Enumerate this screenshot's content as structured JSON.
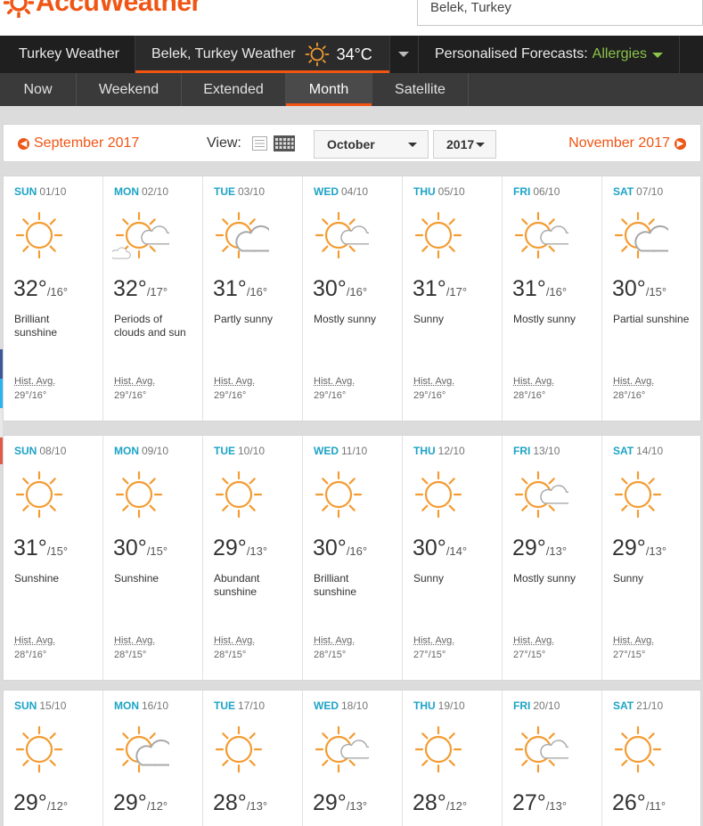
{
  "header": {
    "logo_text": "AccuWeather",
    "search_value": "Belek, Turkey"
  },
  "nav1": {
    "country": "Turkey Weather",
    "city": "Belek, Turkey Weather",
    "current_temp": "34°C",
    "personalised_label": "Personalised Forecasts:",
    "personalised_value": "Allergies"
  },
  "nav2": {
    "tabs": [
      "Now",
      "Weekend",
      "Extended",
      "Month",
      "Satellite"
    ],
    "active": "Month"
  },
  "controls": {
    "prev_month": "September 2017",
    "view_label": "View:",
    "month_select": "October",
    "year_select": "2017",
    "next_month": "November 2017"
  },
  "hist_label": "Hist. Avg.",
  "weeks": [
    [
      {
        "dow": "SUN",
        "date": "01/10",
        "icon": "sun-icon",
        "hi": "32°",
        "lo": "/16°",
        "cond": "Brilliant sunshine",
        "hist": "29°/16°"
      },
      {
        "dow": "MON",
        "date": "02/10",
        "icon": "sun-cloud-small-icon",
        "hi": "32°",
        "lo": "/17°",
        "cond": "Periods of clouds and sun",
        "hist": "29°/16°"
      },
      {
        "dow": "TUE",
        "date": "03/10",
        "icon": "partly-sunny-icon",
        "hi": "31°",
        "lo": "/16°",
        "cond": "Partly sunny",
        "hist": "29°/16°"
      },
      {
        "dow": "WED",
        "date": "04/10",
        "icon": "mostly-sunny-icon",
        "hi": "30°",
        "lo": "/16°",
        "cond": "Mostly sunny",
        "hist": "29°/16°"
      },
      {
        "dow": "THU",
        "date": "05/10",
        "icon": "sun-icon",
        "hi": "31°",
        "lo": "/17°",
        "cond": "Sunny",
        "hist": "29°/16°"
      },
      {
        "dow": "FRI",
        "date": "06/10",
        "icon": "mostly-sunny-icon",
        "hi": "31°",
        "lo": "/16°",
        "cond": "Mostly sunny",
        "hist": "28°/16°"
      },
      {
        "dow": "SAT",
        "date": "07/10",
        "icon": "partly-sunny-icon",
        "hi": "30°",
        "lo": "/15°",
        "cond": "Partial sunshine",
        "hist": "28°/16°"
      }
    ],
    [
      {
        "dow": "SUN",
        "date": "08/10",
        "icon": "sun-icon",
        "hi": "31°",
        "lo": "/15°",
        "cond": "Sunshine",
        "hist": "28°/16°"
      },
      {
        "dow": "MON",
        "date": "09/10",
        "icon": "sun-icon",
        "hi": "30°",
        "lo": "/15°",
        "cond": "Sunshine",
        "hist": "28°/15°"
      },
      {
        "dow": "TUE",
        "date": "10/10",
        "icon": "sun-icon",
        "hi": "29°",
        "lo": "/13°",
        "cond": "Abundant sunshine",
        "hist": "28°/15°"
      },
      {
        "dow": "WED",
        "date": "11/10",
        "icon": "sun-icon",
        "hi": "30°",
        "lo": "/16°",
        "cond": "Brilliant sunshine",
        "hist": "28°/15°"
      },
      {
        "dow": "THU",
        "date": "12/10",
        "icon": "sun-icon",
        "hi": "30°",
        "lo": "/14°",
        "cond": "Sunny",
        "hist": "27°/15°"
      },
      {
        "dow": "FRI",
        "date": "13/10",
        "icon": "mostly-sunny-icon",
        "hi": "29°",
        "lo": "/13°",
        "cond": "Mostly sunny",
        "hist": "27°/15°"
      },
      {
        "dow": "SAT",
        "date": "14/10",
        "icon": "sun-icon",
        "hi": "29°",
        "lo": "/13°",
        "cond": "Sunny",
        "hist": "27°/15°"
      }
    ],
    [
      {
        "dow": "SUN",
        "date": "15/10",
        "icon": "sun-icon",
        "hi": "29°",
        "lo": "/12°",
        "cond": "",
        "hist": ""
      },
      {
        "dow": "MON",
        "date": "16/10",
        "icon": "partly-sunny-icon",
        "hi": "29°",
        "lo": "/12°",
        "cond": "",
        "hist": ""
      },
      {
        "dow": "TUE",
        "date": "17/10",
        "icon": "sun-icon",
        "hi": "28°",
        "lo": "/13°",
        "cond": "",
        "hist": ""
      },
      {
        "dow": "WED",
        "date": "18/10",
        "icon": "mostly-sunny-icon",
        "hi": "29°",
        "lo": "/13°",
        "cond": "",
        "hist": ""
      },
      {
        "dow": "THU",
        "date": "19/10",
        "icon": "sun-icon",
        "hi": "28°",
        "lo": "/12°",
        "cond": "",
        "hist": ""
      },
      {
        "dow": "FRI",
        "date": "20/10",
        "icon": "mostly-sunny-icon",
        "hi": "27°",
        "lo": "/13°",
        "cond": "",
        "hist": ""
      },
      {
        "dow": "SAT",
        "date": "21/10",
        "icon": "sun-icon",
        "hi": "26°",
        "lo": "/11°",
        "cond": "",
        "hist": ""
      }
    ]
  ],
  "colors": {
    "brand_orange": "#f05514",
    "day_blue": "#1da3c6",
    "sun_orange": "#f39c33",
    "cloud_gray": "#a8a8a8",
    "allergy_green": "#8bc34a"
  }
}
